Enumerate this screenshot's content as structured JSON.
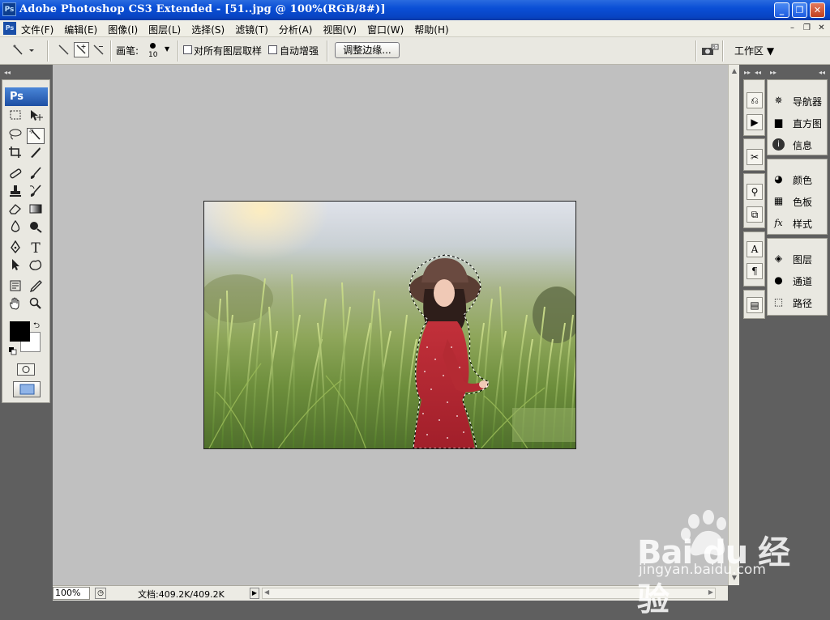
{
  "app": {
    "title": "Adobe Photoshop CS3 Extended - [51..jpg @ 100%(RGB/8#)]",
    "ps_badge": "Ps"
  },
  "window_controls": {
    "minimize": "_",
    "restore": "❐",
    "close": "✕"
  },
  "doc_controls": {
    "minimize": "–",
    "restore": "❐",
    "close": "✕"
  },
  "menu": [
    "文件(F)",
    "编辑(E)",
    "图像(I)",
    "图层(L)",
    "选择(S)",
    "滤镜(T)",
    "分析(A)",
    "视图(V)",
    "窗口(W)",
    "帮助(H)"
  ],
  "options_bar": {
    "brush_label": "画笔:",
    "brush_size": "10",
    "sample_all_layers": "对所有图层取样",
    "auto_enhance": "自动增强",
    "refine_edge_button": "调整边缘...",
    "workspace_label": "工作区 ▼"
  },
  "status_bar": {
    "zoom": "100%",
    "doc_size": "文档:409.2K/409.2K"
  },
  "panels": {
    "group1": [
      "导航器",
      "直方图",
      "信息"
    ],
    "group2": [
      "颜色",
      "色板",
      "样式"
    ],
    "group3": [
      "图层",
      "通道",
      "路径"
    ]
  },
  "colors": {
    "title_bar": "#0a4fd6",
    "canvas_bg": "#c0c0c0",
    "foreground_color": "#000000",
    "background_color": "#ffffff"
  },
  "watermark": {
    "logo": "Bai du 经验",
    "url": "jingyan.baidu.com"
  }
}
